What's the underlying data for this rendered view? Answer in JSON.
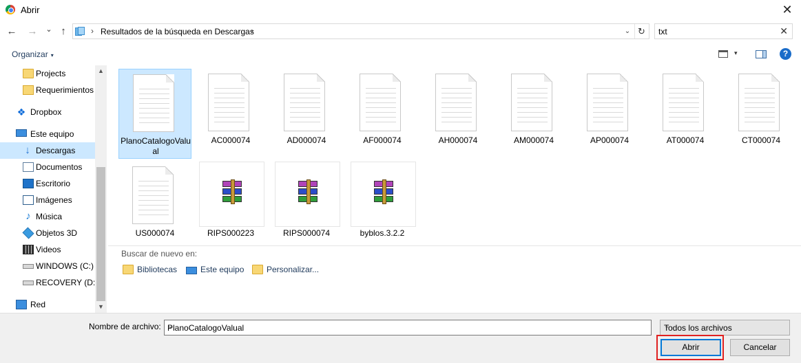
{
  "window": {
    "title": "Abrir",
    "close_glyph": "✕"
  },
  "nav": {
    "back_glyph": "←",
    "forward_glyph": "→",
    "recent_glyph": "⌄",
    "up_glyph": "↑",
    "breadcrumb_sep1": "›",
    "breadcrumb_sep2": "›",
    "path": "Resultados de la búsqueda en Descargas",
    "dropdown_glyph": "⌄",
    "refresh_glyph": "↻"
  },
  "search": {
    "value": "txt",
    "clear_glyph": "✕"
  },
  "toolbar": {
    "organize_label": "Organizar",
    "organize_caret": "▾",
    "view_caret": "▾",
    "help_label": "?"
  },
  "sidebar": {
    "scroll_up": "▲",
    "scroll_down": "▼",
    "items": [
      {
        "label": "Projects",
        "icon": "folder-icon"
      },
      {
        "label": "Requerimientos",
        "icon": "folder-person-icon"
      },
      {
        "label": "Dropbox",
        "icon": "dropbox-icon"
      },
      {
        "label": "Este equipo",
        "icon": "computer-icon"
      },
      {
        "label": "Descargas",
        "icon": "download-icon",
        "selected": true
      },
      {
        "label": "Documentos",
        "icon": "documents-icon"
      },
      {
        "label": "Escritorio",
        "icon": "desktop-icon"
      },
      {
        "label": "Imágenes",
        "icon": "pictures-icon"
      },
      {
        "label": "Música",
        "icon": "music-icon"
      },
      {
        "label": "Objetos 3D",
        "icon": "3d-objects-icon"
      },
      {
        "label": "Videos",
        "icon": "videos-icon"
      },
      {
        "label": "WINDOWS (C:)",
        "icon": "drive-icon"
      },
      {
        "label": "RECOVERY (D:)",
        "icon": "drive-icon"
      },
      {
        "label": "Red",
        "icon": "network-icon"
      }
    ]
  },
  "files": [
    {
      "name": "PlanoCatalogoValual",
      "type": "text-file-icon",
      "selected": true
    },
    {
      "name": "AC000074",
      "type": "text-file-icon"
    },
    {
      "name": "AD000074",
      "type": "text-file-icon"
    },
    {
      "name": "AF000074",
      "type": "text-file-icon"
    },
    {
      "name": "AH000074",
      "type": "text-file-icon"
    },
    {
      "name": "AM000074",
      "type": "text-file-icon"
    },
    {
      "name": "AP000074",
      "type": "text-file-icon"
    },
    {
      "name": "AT000074",
      "type": "text-file-icon"
    },
    {
      "name": "CT000074",
      "type": "text-file-icon"
    },
    {
      "name": "US000074",
      "type": "text-file-icon"
    },
    {
      "name": "RIPS000223",
      "type": "winrar-archive-icon"
    },
    {
      "name": "RIPS000074",
      "type": "winrar-archive-icon"
    },
    {
      "name": "byblos.3.2.2",
      "type": "winrar-archive-icon"
    }
  ],
  "search_again": {
    "label": "Buscar de nuevo en:",
    "links": [
      "Bibliotecas",
      "Este equipo",
      "Personalizar..."
    ]
  },
  "footer": {
    "filename_label": "Nombre de archivo:",
    "filename_value": "PlanoCatalogoValual",
    "filetype_value": "Todos los archivos",
    "dropdown_glyph": "⌄",
    "open_label": "Abrir",
    "cancel_label": "Cancelar"
  },
  "colors": {
    "selection": "#cce8ff",
    "highlight_frame": "#e02020",
    "accent": "#0078d7"
  }
}
